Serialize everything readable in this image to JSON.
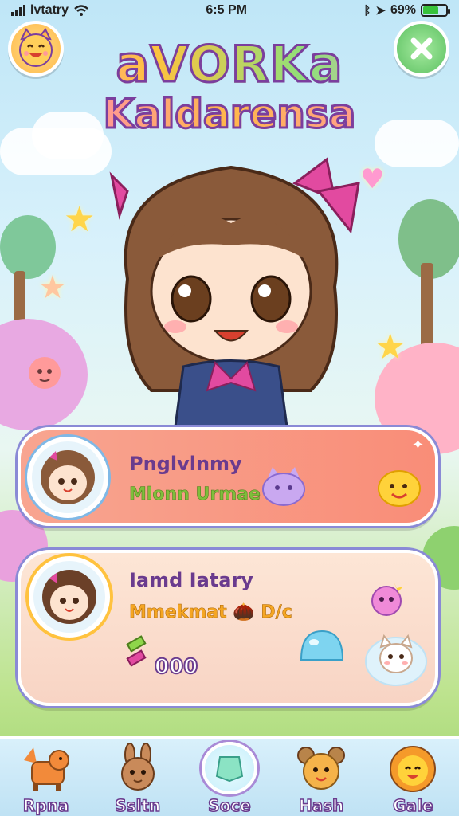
{
  "status_bar": {
    "carrier": "lvtatry",
    "time": "6:5 PM",
    "battery": "69%",
    "battery_level": 0.69
  },
  "header": {
    "title_line1": "aVORKa",
    "title_line2": "Kaldarensa"
  },
  "cards": [
    {
      "name": "Pnglvlnmy",
      "subtitle": "Mlonn Urmae",
      "ring_color": "#7fb8e6"
    },
    {
      "name": "Iamd Iatary",
      "subtitle": "Mmekmat",
      "subtitle_extra": "D/c",
      "count": "000",
      "ring_color": "#ffc23e"
    }
  ],
  "nav": {
    "items": [
      {
        "label": "Rpna",
        "icon": "fox-icon"
      },
      {
        "label": "Ssltn",
        "icon": "bunny-icon"
      },
      {
        "label": "Soce",
        "icon": "gem-icon",
        "active": true
      },
      {
        "label": "Hash",
        "icon": "bear-icon"
      },
      {
        "label": "Gale",
        "icon": "lion-icon"
      }
    ]
  },
  "colors": {
    "accent": "#7b3e9e",
    "card1": "#f98d78",
    "card2": "#fde6d6",
    "nav": "#bfe2f4"
  }
}
